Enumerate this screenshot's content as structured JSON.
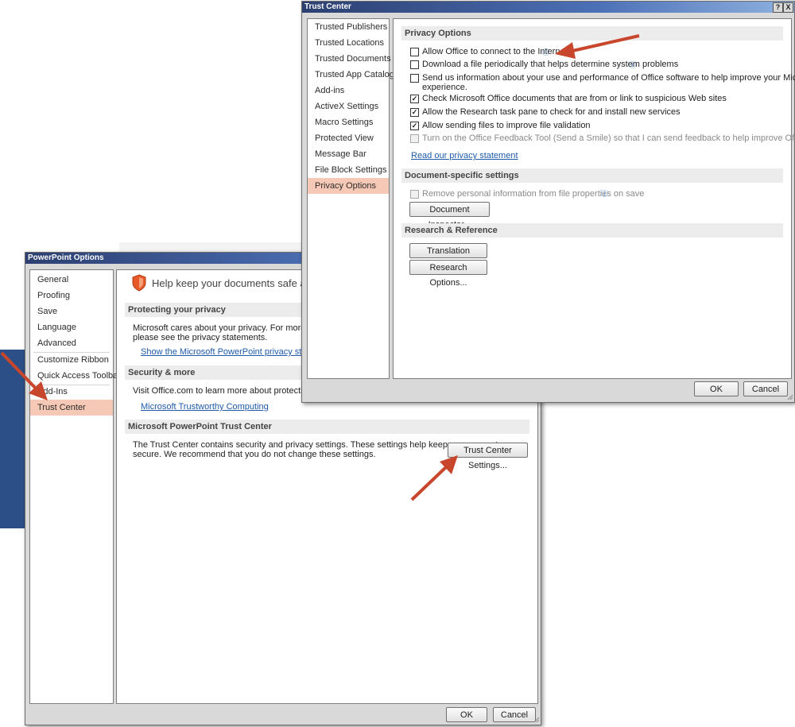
{
  "ppt_options": {
    "title": "PowerPoint Options",
    "nav": [
      "General",
      "Proofing",
      "Save",
      "Language",
      "Advanced",
      "Customize Ribbon",
      "Quick Access Toolbar",
      "Add-Ins",
      "Trust Center"
    ],
    "header_text": "Help keep your documents safe and your co",
    "privacy": {
      "heading": "Protecting your privacy",
      "line1": "Microsoft cares about your privacy. For more informat",
      "line2": "please see the privacy statements.",
      "link": "Show the Microsoft PowerPoint privacy statement"
    },
    "security": {
      "heading": "Security & more",
      "line1": "Visit Office.com to learn more about protecting your p",
      "link": "Microsoft Trustworthy Computing"
    },
    "trust_center": {
      "heading": "Microsoft PowerPoint Trust Center",
      "line1": "The Trust Center contains security and privacy settings. These settings help keep your computer",
      "line2": "secure. We recommend that you do not change these settings.",
      "button": "Trust Center Settings..."
    },
    "ok": "OK",
    "cancel": "Cancel"
  },
  "trust_center": {
    "title": "Trust Center",
    "title_buttons": [
      "?",
      "X"
    ],
    "nav": [
      "Trusted Publishers",
      "Trusted Locations",
      "Trusted Documents",
      "Trusted App Catalogs",
      "Add-ins",
      "ActiveX Settings",
      "Macro Settings",
      "Protected View",
      "Message Bar",
      "File Block Settings",
      "Privacy Options"
    ],
    "privacy_heading": "Privacy Options",
    "options": [
      {
        "label": "Allow Office to connect to the Internet.",
        "checked": false,
        "info": true
      },
      {
        "label": "Download a file periodically that helps determine system problems",
        "checked": false,
        "info": true
      },
      {
        "label": "Send us information about your use and performance of Office software to help improve your Microsoft",
        "label2": "experience.",
        "checked": false
      },
      {
        "label": "Check Microsoft Office documents that are from or link to suspicious Web sites",
        "checked": true
      },
      {
        "label": "Allow the Research task pane to check for and install new services",
        "checked": true
      },
      {
        "label": "Allow sending files to improve file validation",
        "checked": true
      },
      {
        "label": "Turn on the Office Feedback Tool (Send a Smile) so that I can send feedback to help improve Office",
        "checked": false,
        "disabled": true
      }
    ],
    "privacy_link": "Read our privacy statement",
    "doc_heading": "Document-specific settings",
    "doc_option": "Remove personal information from file properties on save",
    "doc_inspector": "Document Inspector...",
    "research_heading": "Research & Reference",
    "translation_btn": "Translation Options...",
    "research_btn": "Research Options...",
    "ok": "OK",
    "cancel": "Cancel",
    "info_glyph": "ⓘ"
  },
  "colors": {
    "accent": "#c8462c",
    "active_nav": "#f6c9b6",
    "link": "#1f5aa8",
    "titlebar": "#2c3f70"
  }
}
